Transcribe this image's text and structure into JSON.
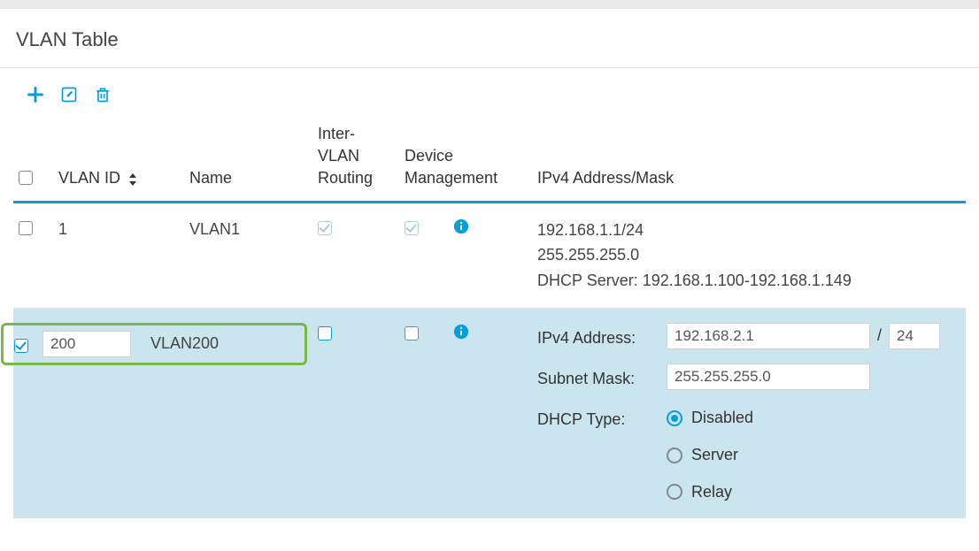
{
  "title": "VLAN Table",
  "columns": {
    "vlan_id": "VLAN ID",
    "name": "Name",
    "inter_vlan_routing": "Inter-\nVLAN\nRouting",
    "device_management": "Device\nManagement",
    "ipv4": "IPv4 Address/Mask"
  },
  "rows": [
    {
      "selected": false,
      "vlan_id": "1",
      "name": "VLAN1",
      "inter_vlan_checked": true,
      "device_mgmt_checked": true,
      "ipv4_line1": "192.168.1.1/24",
      "ipv4_line2": "255.255.255.0",
      "ipv4_line3": "DHCP Server: 192.168.1.100-192.168.1.149"
    }
  ],
  "edit_row": {
    "selected": true,
    "vlan_id": "200",
    "name": "VLAN200",
    "inter_vlan_checked": false,
    "device_mgmt_checked": false,
    "form": {
      "ipv4_label": "IPv4 Address:",
      "ipv4_value": "192.168.2.1",
      "mask_value": "24",
      "subnet_label": "Subnet Mask:",
      "subnet_value": "255.255.255.0",
      "dhcp_label": "DHCP Type:",
      "dhcp_options": [
        {
          "label": "Disabled",
          "selected": true
        },
        {
          "label": "Server",
          "selected": false
        },
        {
          "label": "Relay",
          "selected": false
        }
      ]
    }
  }
}
